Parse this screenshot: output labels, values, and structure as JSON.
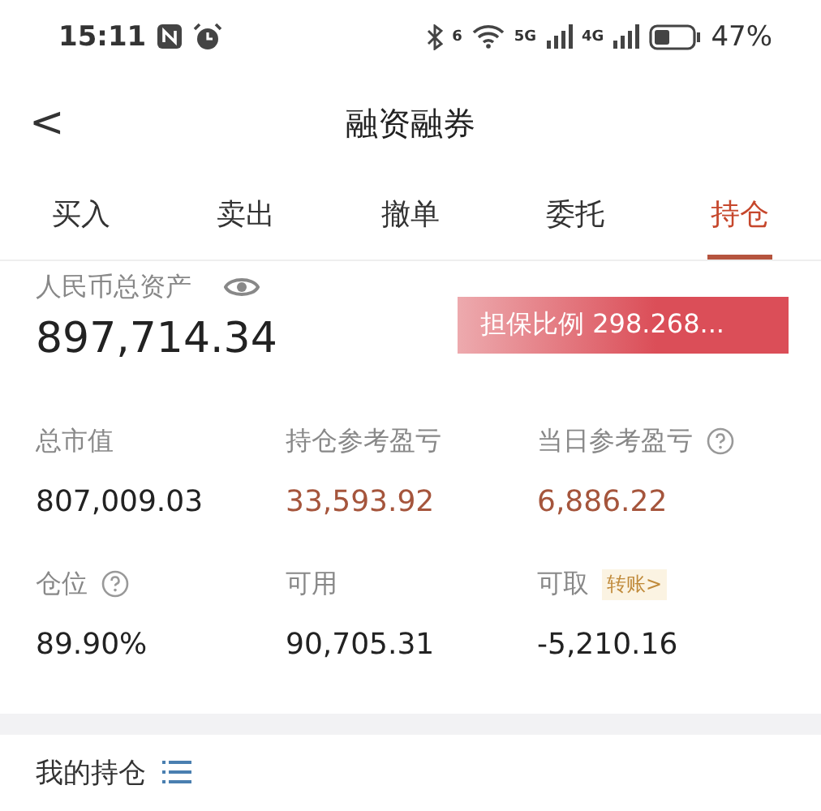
{
  "status_bar": {
    "time": "15:11",
    "wifi_badge": "6",
    "network_5g": "5G",
    "network_4g": "4G",
    "battery": "47%"
  },
  "header": {
    "back": "<",
    "title": "融资融券"
  },
  "tabs": [
    {
      "label": "买入",
      "selected": false
    },
    {
      "label": "卖出",
      "selected": false
    },
    {
      "label": "撤单",
      "selected": false
    },
    {
      "label": "委托",
      "selected": false
    },
    {
      "label": "持仓",
      "selected": true
    }
  ],
  "assets": {
    "label": "人民币总资产",
    "value": "897,714.34",
    "ratio_badge": "担保比例 298.268..."
  },
  "stats": [
    {
      "label": "总市值",
      "value": "807,009.03",
      "color": "#222222",
      "help": false
    },
    {
      "label": "持仓参考盈亏",
      "value": "33,593.92",
      "color": "#a5553c",
      "help": false
    },
    {
      "label": "当日参考盈亏",
      "value": "6,886.22",
      "color": "#a5553c",
      "help": true
    },
    {
      "label": "仓位",
      "value": "89.90%",
      "color": "#222222",
      "help": true
    },
    {
      "label": "可用",
      "value": "90,705.31",
      "color": "#222222",
      "help": false
    },
    {
      "label": "可取",
      "value": "-5,210.16",
      "color": "#222222",
      "help": false,
      "link": "转账>"
    }
  ],
  "holdings": {
    "title": "我的持仓"
  }
}
